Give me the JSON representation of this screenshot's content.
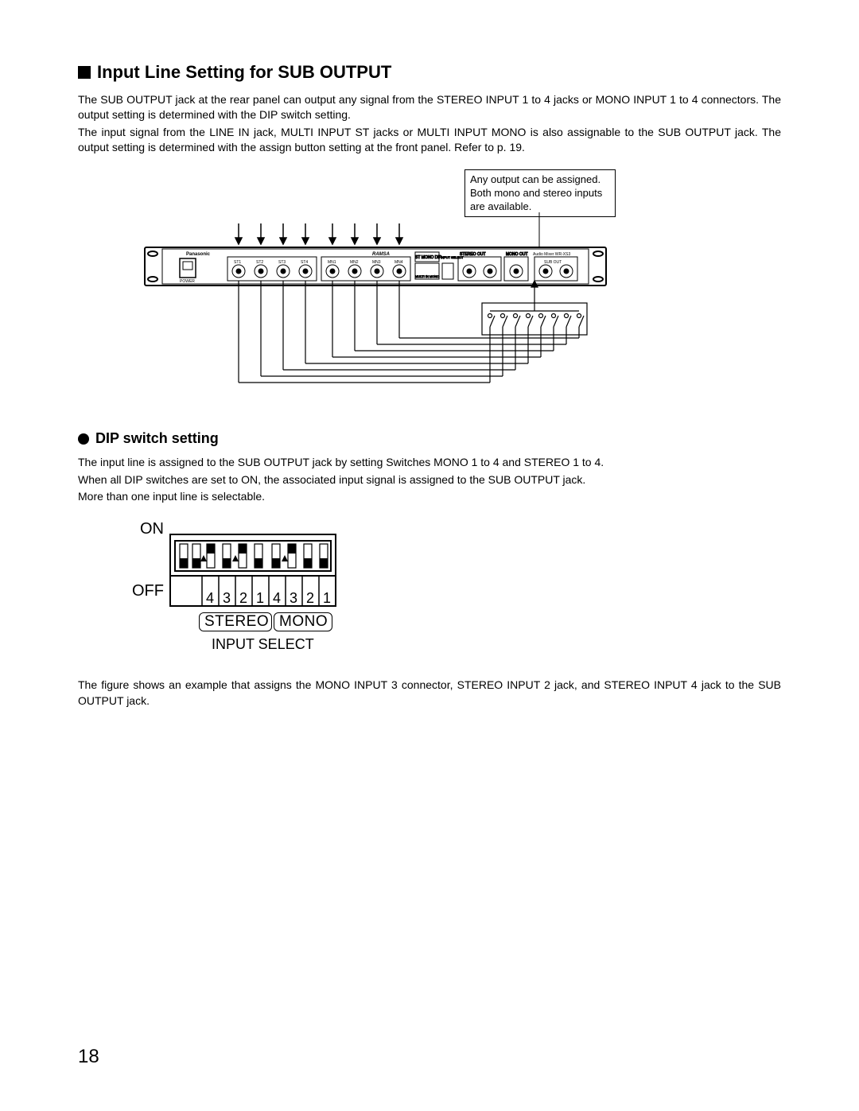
{
  "sectionTitle": "Input Line Setting for SUB OUTPUT",
  "para1a": "The SUB OUTPUT jack at the rear panel can output any signal from the STEREO INPUT 1 to 4 jacks or MONO INPUT 1 to 4 connectors. The output setting is determined with the DIP switch setting.",
  "para1b": "The input signal from the LINE IN jack, MULTI INPUT ST jacks or MULTI INPUT MONO is also assignable to the SUB OUTPUT jack. The output setting is determined with the assign button setting at the front panel. Refer to p. 19.",
  "calloutText": "Any output can be assigned. Both mono and stereo inputs are available.",
  "rack": {
    "brand": "Panasonic",
    "series": "RAMSA",
    "powerLabel": "POWER",
    "stereoInputs": [
      "ST1",
      "ST2",
      "ST3",
      "ST4"
    ],
    "monoInputs": [
      "MN1",
      "MN2",
      "MN3",
      "MN4"
    ],
    "stMonoBox": "ST MONO DIP",
    "multMono": "MULTI IN MONO",
    "inputSelect": "INPUT SELECT",
    "stereoOut": "STEREO OUT",
    "monoOut": "MONO OUT",
    "model": "Audio Mixer WR-XS3",
    "subOut": "SUB OUT"
  },
  "subTitle": "DIP switch setting",
  "para2a": "The input line is assigned to the SUB OUTPUT jack by setting Switches MONO 1 to 4 and STEREO 1 to 4.",
  "para2b": "When all DIP switches are set to ON, the associated input signal is assigned to the SUB OUTPUT jack.",
  "para2c": "More than one input line is selectable.",
  "dip": {
    "on": "ON",
    "off": "OFF",
    "stereoNums": [
      "4",
      "3",
      "2",
      "1"
    ],
    "monoNums": [
      "4",
      "3",
      "2",
      "1"
    ],
    "stereoLabel": "STEREO",
    "monoLabel": "MONO",
    "inputSelect": "INPUT SELECT",
    "switches": {
      "slot0": "down",
      "slot1": "down",
      "stereo4": "up",
      "stereo3": "down",
      "stereo2": "up",
      "stereo1": "down",
      "mono4": "down",
      "mono3": "up",
      "mono2": "down",
      "mono1": "down"
    }
  },
  "para3": "The figure shows an example that assigns the MONO INPUT 3 connector, STEREO INPUT 2 jack, and STEREO INPUT 4 jack to the SUB OUTPUT jack.",
  "pageNumber": "18"
}
